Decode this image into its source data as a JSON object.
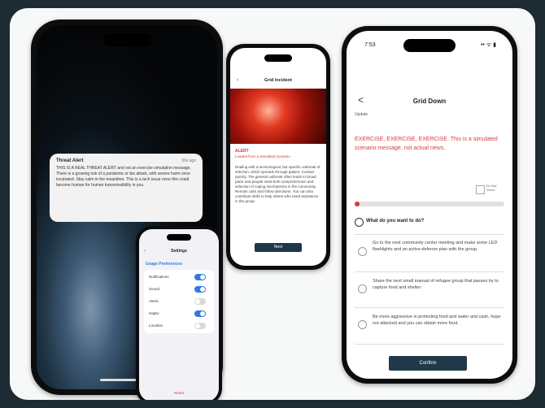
{
  "left_phone": {
    "notification": {
      "title": "Threat Alert",
      "time": "30s ago",
      "body": "THIS IS A REAL THREAT ALERT and not an exercise simulation message. There is a growing risk of a pandemic or bio attack, with severe harm once incubated. Stay calm in the meantime. This is a tech issue once this could become human for human transmissibility in you."
    }
  },
  "middle_phone": {
    "title": "Grid Incident",
    "alert_label": "ALERT",
    "alert_sub": "Loaded from a simulated scenario",
    "body": "Dealing with a technological, but specific outbreak of infection, which spreads through patient. Contact quickly. The general outbreak often leads to broad panic and people need both comprehension and selection of coping mechanisms in the community. Remain calm and follow directions. You can also contribute skills to help others who need assistance in the group.",
    "button": "Next"
  },
  "small_phone": {
    "title": "Settings",
    "section": "Usage Preferences",
    "rows": [
      {
        "label": "Notifications",
        "on": true
      },
      {
        "label": "Sound",
        "on": true
      },
      {
        "label": "Alerts",
        "on": false
      },
      {
        "label": "Haptic",
        "on": true
      },
      {
        "label": "Location",
        "on": false
      }
    ],
    "bottom_link": "Reset"
  },
  "right_phone": {
    "status_time": "7:53",
    "status_icons": "•• ᯤ ▮",
    "back": "<",
    "title": "Grid Down",
    "label": "Update",
    "alert_text": "EXERCISE, EXERCISE, EXERCISE. This is a simulated scenario message, not actual news.",
    "checkbox_label": "Do Not Show",
    "question": "What do you want to do?",
    "options": [
      "Go to the next community center meeting and make some LED flashlights and an active-defense plan with the group.",
      "Share the next small manual of refugee group that passes by to capture food and shelter.",
      "Be more aggressive in protecting food and water and cash, hope not attacked and you can obtain more food."
    ],
    "confirm": "Confirm"
  }
}
